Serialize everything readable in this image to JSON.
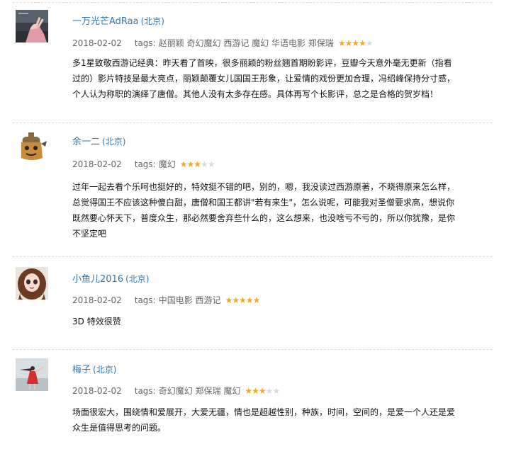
{
  "reviews": [
    {
      "username": "一万光芒AdRaa",
      "location": "(北京)",
      "date": "2018-02-02",
      "tags_label": "tags:",
      "tags": "赵丽颖 奇幻魔幻 西游记 魔幻 华语电影 郑保瑞",
      "rating": 4,
      "comment_lines": [
        "多1星致敬西游记经典：昨天看了首映，很多丽颖的粉丝翘首期盼影评，豆瓣今天意外毫无更新（指看",
        "过的）影片特技是最大亮点，丽颖颠覆女儿国国王形象，让爱情的戏份更加合理，冯绍峰保持分寸感，",
        "个人认为称职的演绎了唐僧。其他人没有太多存在感。具体再写个长影评，总之是合格的贺岁档！"
      ],
      "avatar_icon": "avatar-photo-hand-icon"
    },
    {
      "username": "余一二",
      "location": "(北京)",
      "date": "2018-02-02",
      "tags_label": "tags:",
      "tags": "魔幻",
      "rating": 3,
      "comment_lines": [
        "过年一起去看个乐呵也挺好的，特效挺不错的吧，别的，嗯，我没读过西游原著，不晓得原来怎么样，",
        "总觉得国王不应该这种傻白甜，唐僧和国王都讲\"若有来生\"，怎么说呢，可能我对圣僧要求高，想说你",
        "既然要心怀天下，普度众生，那必然要舍弃些什么的，这么想来，也没啥亏不亏的，所以你犹豫，是你",
        "不坚定吧"
      ],
      "avatar_icon": "avatar-cartoon-bag-icon"
    },
    {
      "username": "小鱼儿2016",
      "location": "(北京)",
      "date": "2018-02-02",
      "tags_label": "tags:",
      "tags": "中国电影 西游记",
      "rating": 5,
      "comment_lines": [
        "3D 特效很赞"
      ],
      "avatar_icon": "avatar-doll-girl-icon"
    },
    {
      "username": "梅子",
      "location": "(北京)",
      "date": "2018-02-02",
      "tags_label": "tags:",
      "tags": "奇幻魔幻 郑保瑞 魔幻",
      "rating": 3,
      "comment_lines": [
        "场面很宏大，围绕情和爱展开，大爱无疆，情也是超越性别，种族，时间，空间的，是爱一个人还是爱",
        "众生是值得思考的问题。"
      ],
      "avatar_icon": "avatar-red-dress-icon"
    }
  ],
  "colors": {
    "link": "#3377aa",
    "star_on": "#f5a623",
    "star_off": "#d9d9d9",
    "divider": "#dddddd"
  }
}
